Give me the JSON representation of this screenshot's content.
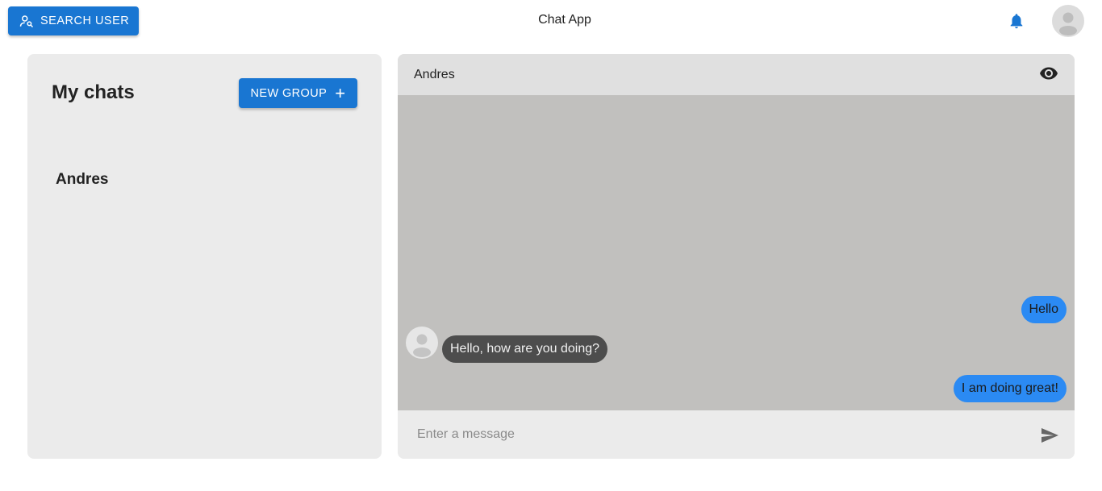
{
  "topbar": {
    "search_label": "SEARCH USER",
    "app_title": "Chat App"
  },
  "sidebar": {
    "title": "My chats",
    "new_group_label": "NEW GROUP",
    "chats": [
      {
        "name": "Andres"
      }
    ]
  },
  "chat": {
    "name": "Andres",
    "messages": [
      {
        "text": "Hello",
        "from": "me"
      },
      {
        "text": "Hello, how are you doing?",
        "from": "them"
      },
      {
        "text": "I am doing great!",
        "from": "me"
      }
    ],
    "input_placeholder": "Enter a message",
    "input_value": ""
  },
  "colors": {
    "primary": "#1976d2",
    "my_bubble": "#2b8af3",
    "their_bubble": "#4d4d4d",
    "messages_bg": "#c1c0be"
  },
  "icons": [
    "search-user-icon",
    "bell-icon",
    "avatar-icon",
    "plus-icon",
    "eye-icon",
    "send-icon"
  ]
}
